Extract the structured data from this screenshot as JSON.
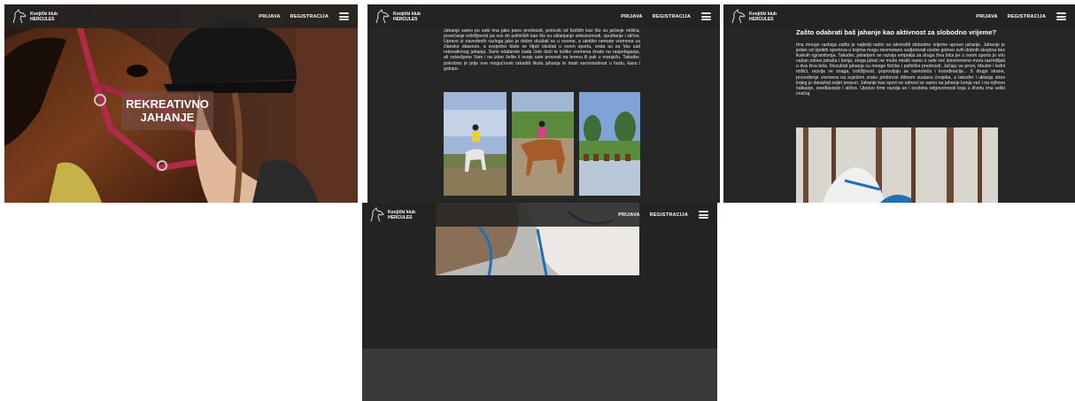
{
  "navbar": {
    "logo_line1": "Konjički klub",
    "logo_line2": "HERCULES",
    "link_prijava": "PRIJAVA",
    "link_registracija": "REGISTRACIJA"
  },
  "hero": {
    "title": "REKREATIVNO JAHANJE"
  },
  "section_intro": {
    "text": "Jahanje samo po sebi ima jako puno prednosti, počevši od fizičkih kao što su jačanje mišića, povećanje izdržljivosti pa sve do psihičkih kao što su uklanjanje anksioznosti, opuštanje i slično. Upravo iz navedenih razloga jako je dobro okušati se u ovome, a ukoliko nemate vremena za članske obaveze, a svejedno biste se htjeli okušati u ovom sportu, onda su za Vas sati rekreativnog jahanja. Sami odabirete kada ćete doći te koliko vremena imate na raspolaganju, ali ostavljamo Vam i na izbor želite li ovaje sate provesti na terenu ili pak u manježu. Također, potrebno je prije ove mogućnosti odraditi školu jahanja te imati samostalnost u hodu, kasu i galopu."
  },
  "section_why": {
    "heading": "Zašto odabrati baš jahanje kao aktivnost za slobodno vrijeme?",
    "text": "Ima mnogo razloga zašto je najbolji način za iskoristiti slobodno vrijeme upravo jahanje. Jahanje je jedan od rijetkih sportova u kojima mogu neometano sudjelovati osobe gotovo svih dobnih skupina bez ikakvih ograničenja. Također, jahanjem se razvija empatija za druga živa bića jer u ovom sportu je vrlo važan odnos jahača i konja, stoga jahač ne može misliti samo o sebi već istovremeno mora razmišljati o dva živa bića. Rezultati jahanja su mnoge fizičke i psihičke prednosti. Jačaju se proni, trbušni i leđni mišići, razvija se snaga, izdržljivost, poprovljaju se ravnoteža i koordinacija... S druge strane, provođenje vremena na svježem zraku pridonosi dišnom sustavu čovjeka, a također i uklanja stres kojeg je današnji svijet prepun. Jahanje kao sport ne odnosi se samo na jahanje konja već i na njihovo čatkanje, osedlavanje i slično. Upravo time razvija se i osobina odgovornosti koja u životu ima veliki značaj."
  },
  "colors": {
    "navbar_bg": "#232323",
    "page_bg": "#262626",
    "footer_bg": "#3a3a3a",
    "text": "#e8e8e8"
  },
  "icons": [
    "horse-logo-icon",
    "hamburger-menu-icon"
  ]
}
